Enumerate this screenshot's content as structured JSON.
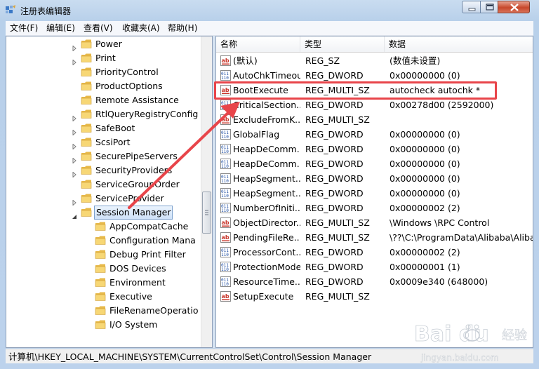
{
  "window": {
    "title": "注册表编辑器"
  },
  "menu": [
    "文件(F)",
    "编辑(E)",
    "查看(V)",
    "收藏夹(A)",
    "帮助(H)"
  ],
  "tree": {
    "items": [
      {
        "label": "Power",
        "level": 1,
        "expander": "collapsed"
      },
      {
        "label": "Print",
        "level": 1,
        "expander": "collapsed"
      },
      {
        "label": "PriorityControl",
        "level": 1,
        "expander": "none"
      },
      {
        "label": "ProductOptions",
        "level": 1,
        "expander": "none"
      },
      {
        "label": "Remote Assistance",
        "level": 1,
        "expander": "none"
      },
      {
        "label": "RtlQueryRegistryConfig",
        "level": 1,
        "expander": "collapsed"
      },
      {
        "label": "SafeBoot",
        "level": 1,
        "expander": "collapsed"
      },
      {
        "label": "ScsiPort",
        "level": 1,
        "expander": "collapsed"
      },
      {
        "label": "SecurePipeServers",
        "level": 1,
        "expander": "collapsed"
      },
      {
        "label": "SecurityProviders",
        "level": 1,
        "expander": "collapsed"
      },
      {
        "label": "ServiceGroupOrder",
        "level": 1,
        "expander": "none"
      },
      {
        "label": "ServiceProvider",
        "level": 1,
        "expander": "collapsed"
      },
      {
        "label": "Session Manager",
        "level": 1,
        "expander": "expanded",
        "selected": true
      },
      {
        "label": "AppCompatCache",
        "level": 2,
        "expander": "none"
      },
      {
        "label": "Configuration Mana",
        "level": 2,
        "expander": "none"
      },
      {
        "label": "Debug Print Filter",
        "level": 2,
        "expander": "none"
      },
      {
        "label": "DOS Devices",
        "level": 2,
        "expander": "none"
      },
      {
        "label": "Environment",
        "level": 2,
        "expander": "none"
      },
      {
        "label": "Executive",
        "level": 2,
        "expander": "none"
      },
      {
        "label": "FileRenameOperatio",
        "level": 2,
        "expander": "none"
      },
      {
        "label": "I/O System",
        "level": 2,
        "expander": "none"
      }
    ]
  },
  "list": {
    "columns": [
      "名称",
      "类型",
      "数据"
    ],
    "rows": [
      {
        "icon": "string-value-icon",
        "name": "(默认)",
        "type": "REG_SZ",
        "data": "(数值未设置)"
      },
      {
        "icon": "binary-value-icon",
        "name": "AutoChkTimeout",
        "type": "REG_DWORD",
        "data": "0x00000000 (0)"
      },
      {
        "icon": "string-value-icon",
        "name": "BootExecute",
        "type": "REG_MULTI_SZ",
        "data": "autocheck autochk *"
      },
      {
        "icon": "binary-value-icon",
        "name": "CriticalSection...",
        "type": "REG_DWORD",
        "data": "0x00278d00 (2592000)"
      },
      {
        "icon": "string-value-icon",
        "name": "ExcludeFromK...",
        "type": "REG_MULTI_SZ",
        "data": ""
      },
      {
        "icon": "binary-value-icon",
        "name": "GlobalFlag",
        "type": "REG_DWORD",
        "data": "0x00000000 (0)"
      },
      {
        "icon": "binary-value-icon",
        "name": "HeapDeComm...",
        "type": "REG_DWORD",
        "data": "0x00000000 (0)"
      },
      {
        "icon": "binary-value-icon",
        "name": "HeapDeComm...",
        "type": "REG_DWORD",
        "data": "0x00000000 (0)"
      },
      {
        "icon": "binary-value-icon",
        "name": "HeapSegment...",
        "type": "REG_DWORD",
        "data": "0x00000000 (0)"
      },
      {
        "icon": "binary-value-icon",
        "name": "HeapSegment...",
        "type": "REG_DWORD",
        "data": "0x00000000 (0)"
      },
      {
        "icon": "binary-value-icon",
        "name": "NumberOfIniti...",
        "type": "REG_DWORD",
        "data": "0x00000002 (2)"
      },
      {
        "icon": "string-value-icon",
        "name": "ObjectDirector...",
        "type": "REG_MULTI_SZ",
        "data": "\\Windows \\RPC Control"
      },
      {
        "icon": "string-value-icon",
        "name": "PendingFileRe...",
        "type": "REG_MULTI_SZ",
        "data": "\\??\\C:\\ProgramData\\Alibaba\\Alibab"
      },
      {
        "icon": "binary-value-icon",
        "name": "ProcessorCont...",
        "type": "REG_DWORD",
        "data": "0x00000002 (2)"
      },
      {
        "icon": "binary-value-icon",
        "name": "ProtectionMode",
        "type": "REG_DWORD",
        "data": "0x00000001 (1)"
      },
      {
        "icon": "binary-value-icon",
        "name": "ResourceTime...",
        "type": "REG_DWORD",
        "data": "0x0009e340 (648000)"
      },
      {
        "icon": "string-value-icon",
        "name": "SetupExecute",
        "type": "REG_MULTI_SZ",
        "data": ""
      }
    ]
  },
  "status": {
    "path": "计算机\\HKEY_LOCAL_MACHINE\\SYSTEM\\CurrentControlSet\\Control\\Session Manager"
  },
  "watermark": {
    "brand": "Bai du",
    "subtitle": "经验",
    "domain": "jingyan.baidu.com"
  },
  "colors": {
    "highlight": "#e8454a",
    "selection_border": "#7da2ce"
  }
}
